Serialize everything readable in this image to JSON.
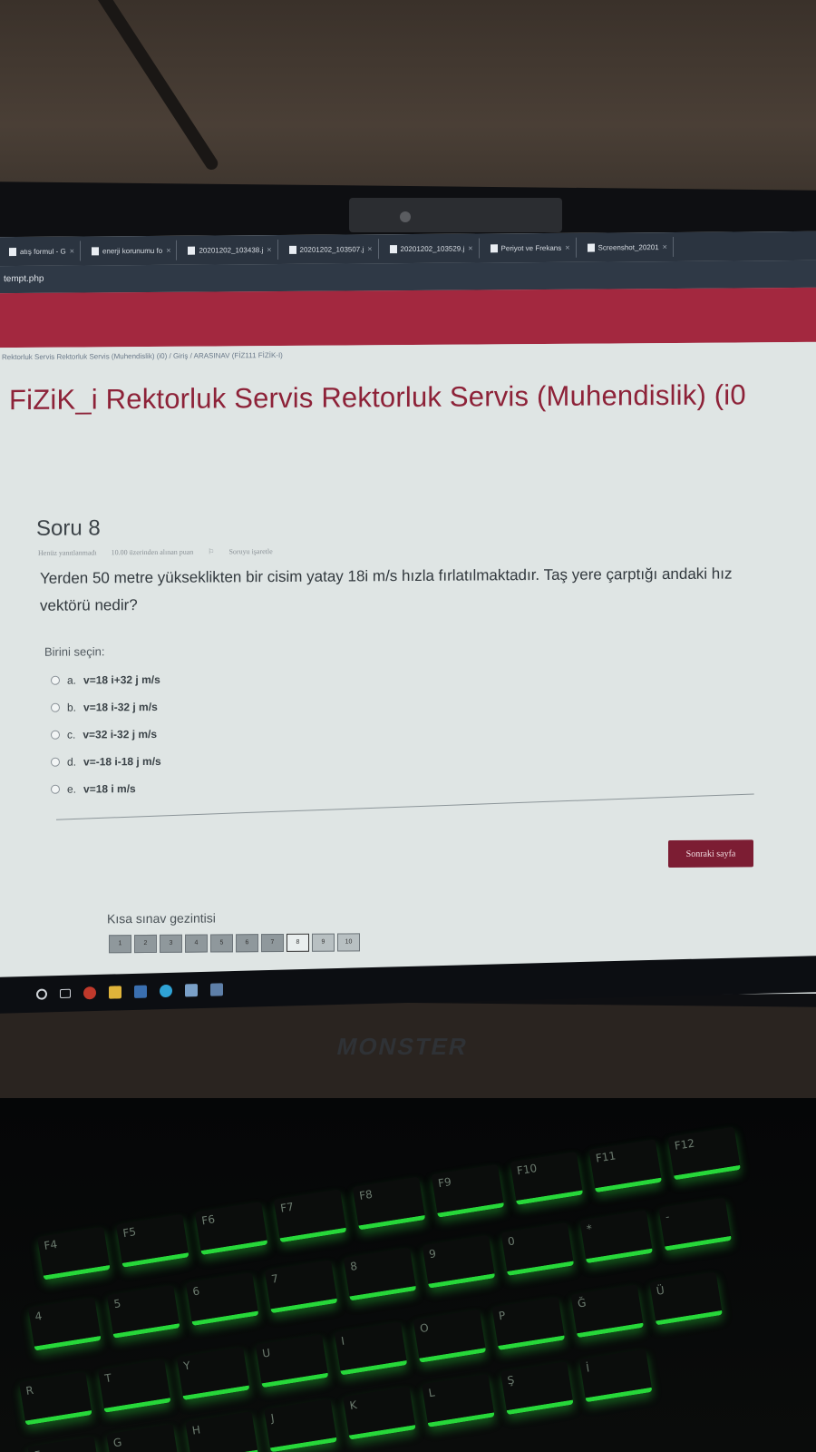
{
  "browser": {
    "tabs": [
      {
        "label": "atış formul - G",
        "icon": "google-icon"
      },
      {
        "label": "enerji korunumu fo",
        "icon": "google-icon"
      },
      {
        "label": "20201202_103438.j",
        "icon": "file-icon"
      },
      {
        "label": "20201202_103507.j",
        "icon": "file-icon"
      },
      {
        "label": "20201202_103529.j",
        "icon": "file-icon"
      },
      {
        "label": "Periyot ve Frekans",
        "icon": "file-icon"
      },
      {
        "label": "Screenshot_20201",
        "icon": "file-icon"
      }
    ],
    "tab_close": "×",
    "url": "tempt.php"
  },
  "page": {
    "breadcrumb": "Rektorluk Servis Rektorluk Servis (Muhendislik) (i0)  /  Giriş  /  ARASINAV (FİZ111 FİZİK-I)",
    "course_title": "FiZiK_i Rektorluk Servis Rektorluk Servis (Muhendislik) (i0",
    "question": {
      "heading": "Soru 8",
      "status": "Henüz yanıtlanmadı",
      "points": "10.00 üzerinden alınan puan",
      "flag": "Soruyu işaretle",
      "text": "Yerden 50 metre yükseklikten bir cisim yatay 18i m/s hızla fırlatılmaktadır. Taş yere çarptığı andaki hız vektörü nedir?",
      "choose_label": "Birini seçin:",
      "options": [
        {
          "letter": "a.",
          "value": "v=18 i+32 j m/s"
        },
        {
          "letter": "b.",
          "value": "v=18 i-32 j m/s"
        },
        {
          "letter": "c.",
          "value": "v=32 i-32 j m/s"
        },
        {
          "letter": "d.",
          "value": "v=-18 i-18 j m/s"
        },
        {
          "letter": "e.",
          "value": "v=18 i m/s"
        }
      ]
    },
    "next_button": "Sonraki sayfa",
    "quiz_nav": {
      "title": "Kısa sınav gezintisi",
      "pages": [
        "1",
        "2",
        "3",
        "4",
        "5",
        "6",
        "7",
        "8",
        "9",
        "10"
      ]
    }
  },
  "hardware": {
    "brand": "MONSTER",
    "keys_row1": [
      "F4",
      "F5",
      "F6",
      "F7",
      "F8",
      "F9",
      "F10",
      "F11",
      "F12"
    ],
    "keys_row2": [
      "4",
      "5",
      "6",
      "7",
      "8",
      "9",
      "0",
      "*",
      "-"
    ],
    "keys_row3": [
      "R",
      "T",
      "Y",
      "U",
      "I",
      "O",
      "P",
      "Ğ",
      "Ü"
    ],
    "keys_row4": [
      "F",
      "G",
      "H",
      "J",
      "K",
      "L",
      "Ş",
      "İ"
    ]
  }
}
